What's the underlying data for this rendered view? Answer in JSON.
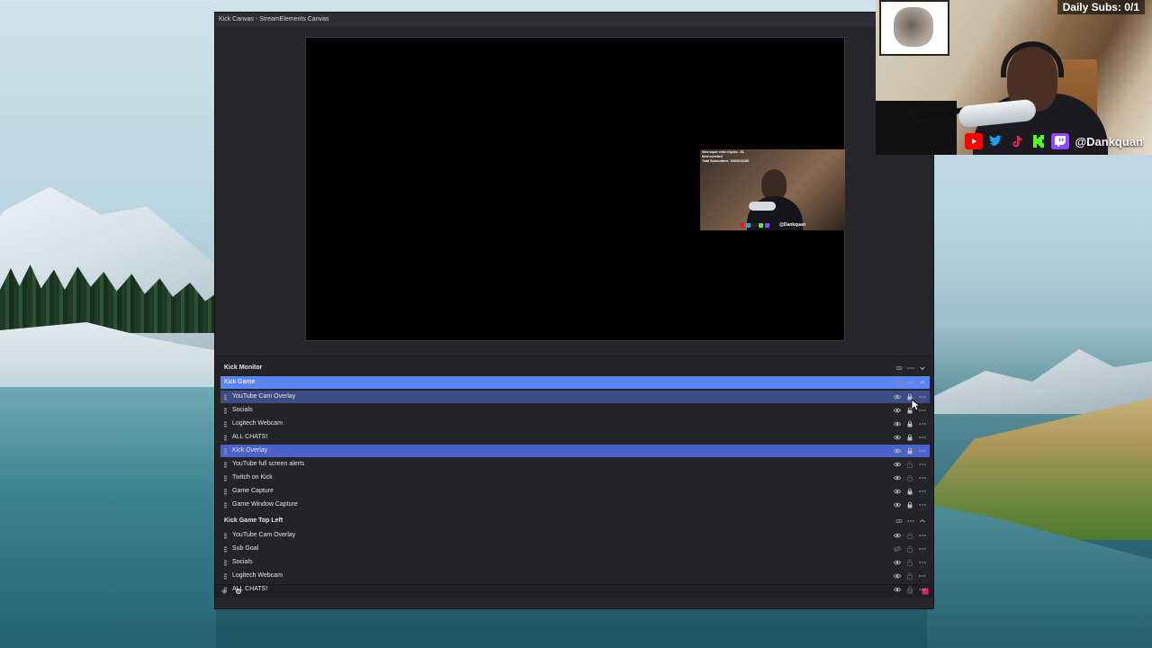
{
  "window": {
    "title": "Kick Canvas - StreamElements Canvas"
  },
  "preview": {
    "mini_overlay": {
      "lines": [
        "New super chat: Glycko - $1",
        "Next member!",
        "Total Subscribers: 19000/19185"
      ],
      "handle": "@Dankquan"
    }
  },
  "layers": {
    "groups": [
      {
        "name": "Kick Monitor",
        "state": "collapsed"
      },
      {
        "name": "Kick Game",
        "state": "active",
        "items": [
          {
            "label": "YouTube Cam Overlay",
            "visible": true,
            "locked": true,
            "highlight": "hover"
          },
          {
            "label": "Socials",
            "visible": true,
            "locked": true
          },
          {
            "label": "Logitech Webcam",
            "visible": true,
            "locked": true
          },
          {
            "label": "ALL CHATS!",
            "visible": true,
            "locked": true
          },
          {
            "label": "Kick Overlay",
            "visible": true,
            "locked": true,
            "highlight": "selected"
          },
          {
            "label": "YouTube full screen alerts",
            "visible": true,
            "locked": false
          },
          {
            "label": "Twitch on Kick",
            "visible": true,
            "locked": false
          },
          {
            "label": "Game Capture",
            "visible": true,
            "locked": true
          },
          {
            "label": "Game Window Capture",
            "visible": true,
            "locked": true
          }
        ]
      },
      {
        "name": "Kick Game Top Left",
        "state": "expanded",
        "items": [
          {
            "label": "YouTube Cam Overlay",
            "visible": true,
            "locked": false
          },
          {
            "label": "Sub Goal",
            "visible": false,
            "locked": false
          },
          {
            "label": "Socials",
            "visible": true,
            "locked": false
          },
          {
            "label": "Logitech Webcam",
            "visible": true,
            "locked": false
          },
          {
            "label": "ALL CHATS!",
            "visible": true,
            "locked": false
          }
        ]
      }
    ]
  },
  "webcam": {
    "daily_subs": "Daily Subs: 0/1",
    "handle": "@Dankquan",
    "social_icons": [
      "youtube-icon",
      "twitter-icon",
      "tiktok-icon",
      "kick-icon",
      "twitch-icon"
    ]
  },
  "colors": {
    "active_group": "#5a86f5",
    "selected_row": "#4a62c9",
    "hover_row": "#3d4b86",
    "record_button": "#e0245e"
  }
}
